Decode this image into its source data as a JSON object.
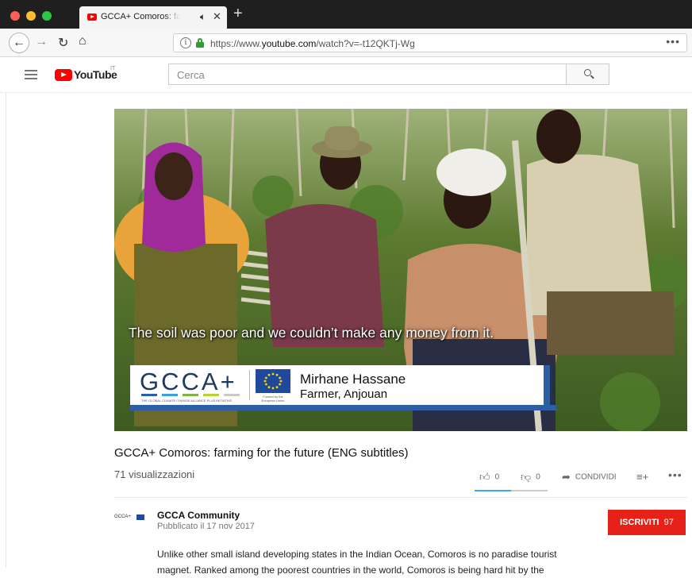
{
  "browser": {
    "tab_title": "GCCA+ Comoros: farming for the future",
    "tab_audio_icon": "speaker-icon",
    "url_prefix": "https://www.",
    "url_domain": "youtube.com",
    "url_path": "/watch?v=-t12QKTj-Wg"
  },
  "youtube": {
    "logo_text": "YouTube",
    "logo_region": "IT",
    "search_placeholder": "Cerca"
  },
  "video": {
    "subtitle": "The soil was poor and we couldn’t make any money from it.",
    "lower_third": {
      "logo": "GCCA+",
      "tagline": "THE GLOBAL CLIMATE CHANGE ALLIANCE PLUS INITIATIVE",
      "funded_by": "Funded by the European Union",
      "name": "Mirhane Hassane",
      "role": "Farmer, Anjouan"
    },
    "stripe_colors": [
      "#2d5fa5",
      "#3aa0d8",
      "#7ab648",
      "#b8d335",
      "#c9c9c9"
    ]
  },
  "info": {
    "title": "GCCA+ Comoros: farming for the future (ENG subtitles)",
    "views": "71 visualizzazioni",
    "likes": "0",
    "dislikes": "0",
    "share_label": "CONDIVIDI",
    "like_ratio": 0.5
  },
  "channel": {
    "avatar_text": "GCCA+",
    "name": "GCCA Community",
    "published": "Pubblicato il 17 nov 2017",
    "subscribe_label": "ISCRIVITI",
    "subscriber_count": "97"
  },
  "description": "Unlike other small island developing states in the Indian Ocean, Comoros is no paradise tourist magnet. Ranked among the poorest countries in the world, Comoros is being hard hit by the",
  "colors": {
    "youtube_red": "#ff0000",
    "subscribe_red": "#e62117",
    "gcca_blue": "#2d5fa5"
  }
}
